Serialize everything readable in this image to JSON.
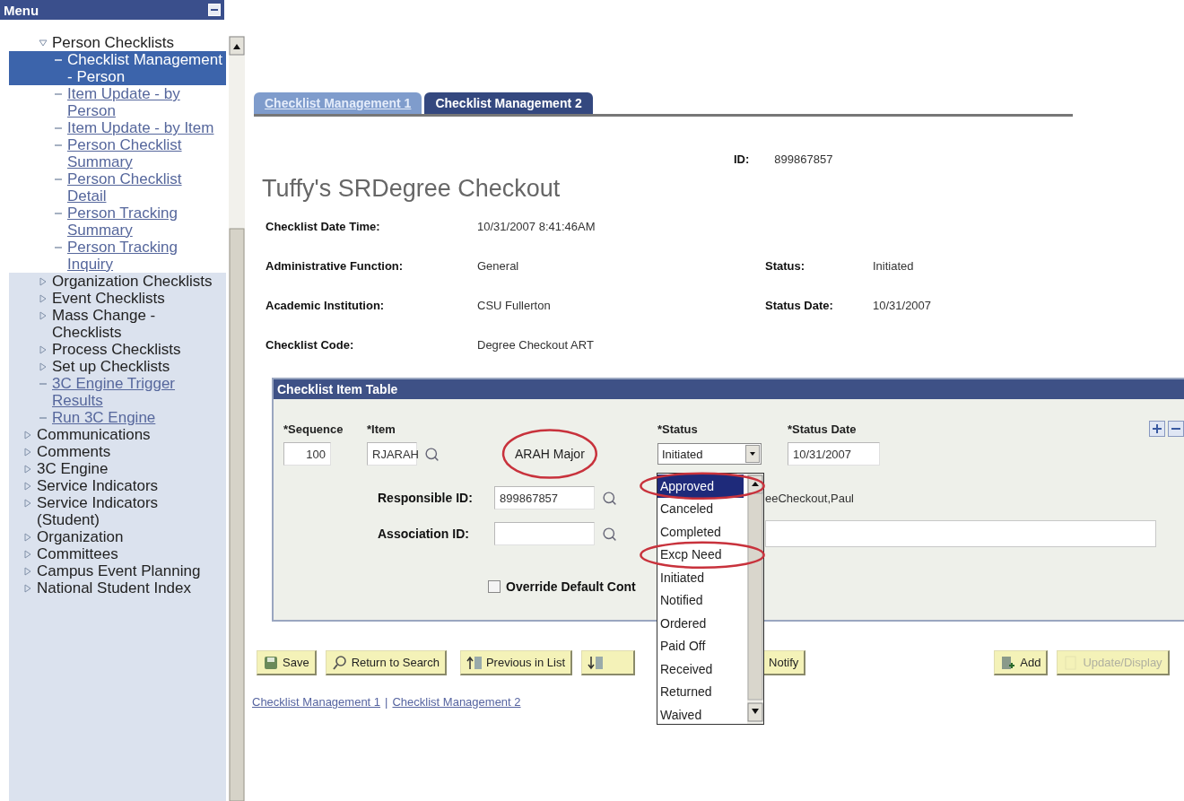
{
  "sidebar": {
    "title": "Menu",
    "scrolled_items": [
      {
        "label": "Person Checklists",
        "kind": "folder",
        "expanded": true,
        "children": [
          {
            "label": "Checklist Management - Person",
            "kind": "link",
            "selected": true
          },
          {
            "label": "Item Update - by Person",
            "kind": "link",
            "selected": false
          },
          {
            "label": "Item Update - by Item",
            "kind": "link",
            "selected": false
          },
          {
            "label": "Person Checklist Summary",
            "kind": "link",
            "selected": false
          },
          {
            "label": "Person Checklist Detail",
            "kind": "link",
            "selected": false
          },
          {
            "label": "Person Tracking Summary",
            "kind": "link",
            "selected": false
          },
          {
            "label": "Person Tracking Inquiry",
            "kind": "link",
            "selected": false
          }
        ]
      },
      {
        "label": "Organization Checklists",
        "kind": "folder",
        "expanded": false
      },
      {
        "label": "Event Checklists",
        "kind": "folder",
        "expanded": false
      },
      {
        "label": "Mass Change - Checklists",
        "kind": "folder",
        "expanded": false
      },
      {
        "label": "Process Checklists",
        "kind": "folder",
        "expanded": false
      },
      {
        "label": "Set up Checklists",
        "kind": "folder",
        "expanded": false
      },
      {
        "label": "3C Engine Trigger Results",
        "kind": "link",
        "selected": false
      },
      {
        "label": "Run 3C Engine",
        "kind": "link",
        "selected": false
      }
    ],
    "items": [
      {
        "label": "Communications",
        "kind": "folder",
        "expanded": false
      },
      {
        "label": "Comments",
        "kind": "folder",
        "expanded": false
      },
      {
        "label": "3C Engine",
        "kind": "folder",
        "expanded": false
      },
      {
        "label": "Service Indicators",
        "kind": "folder",
        "expanded": false
      },
      {
        "label": "Service Indicators (Student)",
        "kind": "folder",
        "expanded": false
      },
      {
        "label": "Organization",
        "kind": "folder",
        "expanded": false
      },
      {
        "label": "Committees",
        "kind": "folder",
        "expanded": false
      },
      {
        "label": "Campus Event Planning",
        "kind": "folder",
        "expanded": false
      },
      {
        "label": "National Student Index",
        "kind": "folder",
        "expanded": false
      }
    ]
  },
  "tabs": [
    {
      "label": "Checklist Management 1",
      "selected": false
    },
    {
      "label": "Checklist Management 2",
      "selected": true
    }
  ],
  "id": {
    "label": "ID:",
    "value": "899867857"
  },
  "title": "Tuffy's SRDegree Checkout",
  "fields": [
    {
      "label": "Checklist Date Time:",
      "value": "10/31/2007 8:41:46AM"
    },
    {
      "label": "Administrative Function:",
      "value": "General",
      "side": {
        "label": "Status:",
        "value": "Initiated"
      }
    },
    {
      "label": "Academic Institution:",
      "value": "CSU Fullerton",
      "side": {
        "label": "Status Date:",
        "value": "10/31/2007"
      }
    },
    {
      "label": "Checklist Code:",
      "value": "Degree Checkout ART"
    }
  ],
  "item_table": {
    "title": "Checklist Item Table",
    "columns": [
      "*Sequence",
      "*Item",
      "*Status",
      "*Status Date"
    ],
    "sequence": "100",
    "item": "RJARAH",
    "description": "ARAH Major",
    "description_circled": true,
    "status": "Initiated",
    "status_date": "10/31/2007",
    "responsible_label": "Responsible ID:",
    "responsible_id": "899867857",
    "responsible_name": "eeCheckout,Paul",
    "association_label": "Association ID:",
    "override": {
      "label": "Override Default Cont",
      "checked": false
    }
  },
  "status_options": [
    {
      "label": "Approved",
      "selected": true,
      "circled": true
    },
    {
      "label": "Canceled",
      "selected": false,
      "circled": false
    },
    {
      "label": "Completed",
      "selected": false,
      "circled": false
    },
    {
      "label": "Excp Need",
      "selected": false,
      "circled": true
    },
    {
      "label": "Initiated",
      "selected": false,
      "circled": false
    },
    {
      "label": "Notified",
      "selected": false,
      "circled": false
    },
    {
      "label": "Ordered",
      "selected": false,
      "circled": false
    },
    {
      "label": "Paid Off",
      "selected": false,
      "circled": false
    },
    {
      "label": "Received",
      "selected": false,
      "circled": false
    },
    {
      "label": "Returned",
      "selected": false,
      "circled": false
    },
    {
      "label": "Waived",
      "selected": false,
      "circled": false
    }
  ],
  "buttons": [
    {
      "kind": "save",
      "label": "Save",
      "disabled": false
    },
    {
      "kind": "search",
      "label": "Return to Search",
      "disabled": false
    },
    {
      "kind": "previous",
      "label": "Previous in List",
      "disabled": false
    },
    {
      "kind": "next",
      "disabled": false
    },
    {
      "kind": "notify",
      "label": "Notify",
      "disabled": false
    },
    {
      "kind": "add",
      "label": "Add",
      "disabled": false
    },
    {
      "kind": "update",
      "label": "Update/Display",
      "disabled": true
    }
  ],
  "bottom_links": [
    {
      "label": "Checklist Management 1"
    },
    {
      "label": "Checklist Management 2"
    }
  ],
  "link_separator": "|"
}
